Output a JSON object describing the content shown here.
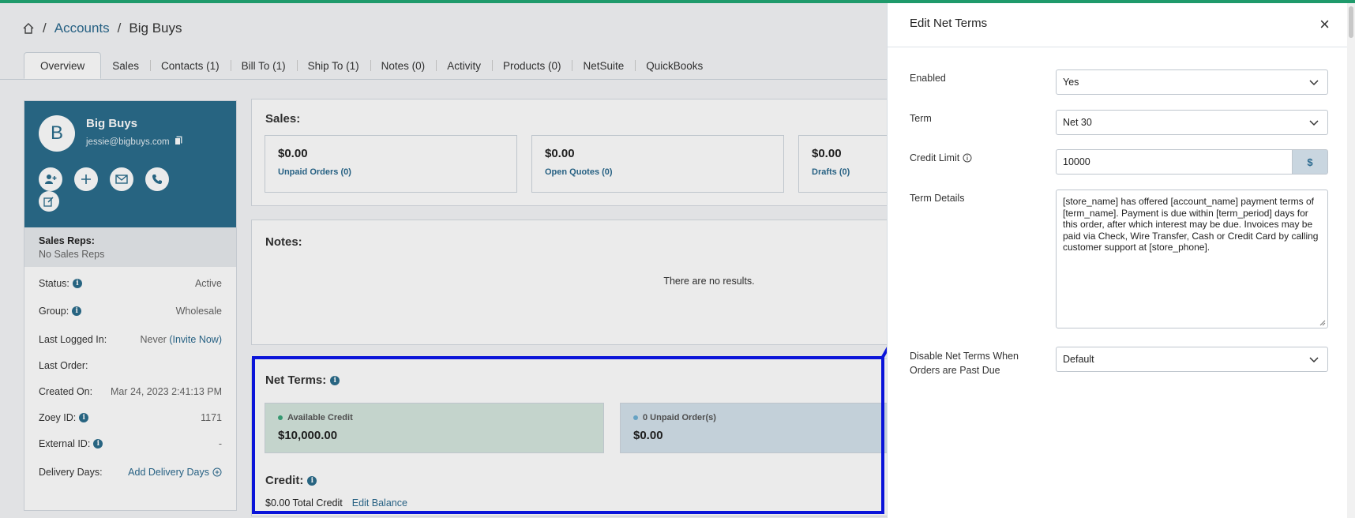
{
  "breadcrumb": {
    "accounts": "Accounts",
    "current": "Big Buys",
    "sep": "/"
  },
  "tabs": [
    "Overview",
    "Sales",
    "Contacts (1)",
    "Bill To (1)",
    "Ship To (1)",
    "Notes (0)",
    "Activity",
    "Products (0)",
    "NetSuite",
    "QuickBooks"
  ],
  "profile": {
    "initial": "B",
    "name": "Big Buys",
    "email": "jessie@bigbuys.com"
  },
  "sales_reps": {
    "title": "Sales Reps:",
    "value": "No Sales Reps"
  },
  "info": {
    "status": {
      "label": "Status:",
      "value": "Active"
    },
    "group": {
      "label": "Group:",
      "value": "Wholesale"
    },
    "last_logged": {
      "label": "Last Logged In:",
      "value": "Never",
      "invite": "(Invite Now)"
    },
    "last_order": {
      "label": "Last Order:",
      "value": ""
    },
    "created": {
      "label": "Created On:",
      "value": "Mar 24, 2023 2:41:13 PM"
    },
    "zoey": {
      "label": "Zoey ID:",
      "value": "1171"
    },
    "external": {
      "label": "External ID:",
      "value": "-"
    },
    "delivery": {
      "label": "Delivery Days:",
      "value": "Add Delivery Days"
    }
  },
  "sales": {
    "title": "Sales:",
    "stats": [
      {
        "amount": "$0.00",
        "label": "Unpaid Orders (0)"
      },
      {
        "amount": "$0.00",
        "label": "Open Quotes (0)"
      },
      {
        "amount": "$0.00",
        "label": "Drafts (0)"
      }
    ]
  },
  "notes": {
    "title": "Notes:",
    "empty": "There are no results."
  },
  "net_terms": {
    "title": "Net Terms:",
    "available": {
      "label": "Available Credit",
      "value": "$10,000.00",
      "color": "#3aa57a"
    },
    "unpaid": {
      "label": "0 Unpaid Order(s)",
      "value": "$0.00",
      "color": "#6fb0d4"
    }
  },
  "credit": {
    "title": "Credit:",
    "total": "$0.00 Total Credit",
    "edit": "Edit Balance"
  },
  "drawer": {
    "title": "Edit Net Terms",
    "close": "×",
    "enabled": {
      "label": "Enabled",
      "value": "Yes"
    },
    "term": {
      "label": "Term",
      "value": "Net 30"
    },
    "credit_limit": {
      "label": "Credit Limit",
      "value": "10000",
      "addon": "$"
    },
    "term_details": {
      "label": "Term Details",
      "value": "[store_name] has offered [account_name] payment terms of [term_name]. Payment is due within [term_period] days for this order, after which interest may be due. Invoices may be paid via Check, Wire Transfer, Cash or Credit Card by calling customer support at [store_phone]."
    },
    "disable": {
      "label": "Disable Net Terms When Orders are Past Due",
      "value": "Default"
    }
  },
  "colors": {
    "accent": "#2b6d8c",
    "highlight": "#0a14d9",
    "topbar": "#1f9a6b"
  }
}
